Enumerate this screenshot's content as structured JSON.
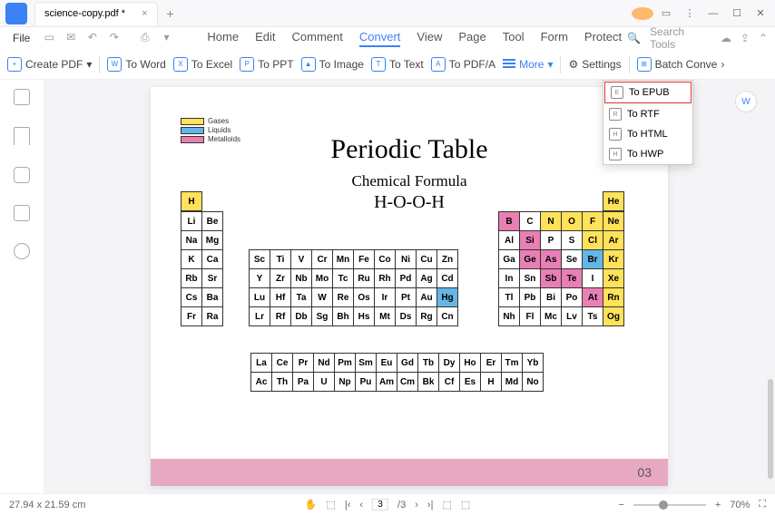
{
  "tab": {
    "title": "science-copy.pdf *"
  },
  "file_menu": "File",
  "main_tabs": [
    "Home",
    "Edit",
    "Comment",
    "Convert",
    "View",
    "Page",
    "Tool",
    "Form",
    "Protect"
  ],
  "active_tab_index": 3,
  "search_placeholder": "Search Tools",
  "ribbon": {
    "create": "Create PDF",
    "word": "To Word",
    "excel": "To Excel",
    "ppt": "To PPT",
    "image": "To Image",
    "text": "To Text",
    "pdfa": "To PDF/A",
    "more": "More",
    "settings": "Settings",
    "batch": "Batch Conve"
  },
  "dropdown": {
    "epub": "To EPUB",
    "rtf": "To RTF",
    "html": "To HTML",
    "hwp": "To HWP"
  },
  "document": {
    "title": "Periodic Table",
    "subtitle": "Chemical Formula",
    "formula": "H-O-O-H",
    "legend": {
      "gas": "Gases",
      "liquid": "Liquids",
      "metalloid": "Metalloids"
    },
    "page_number": "03"
  },
  "status": {
    "dimensions": "27.94 x 21.59 cm",
    "page_current": "3",
    "page_total": "/3",
    "zoom": "70%"
  }
}
